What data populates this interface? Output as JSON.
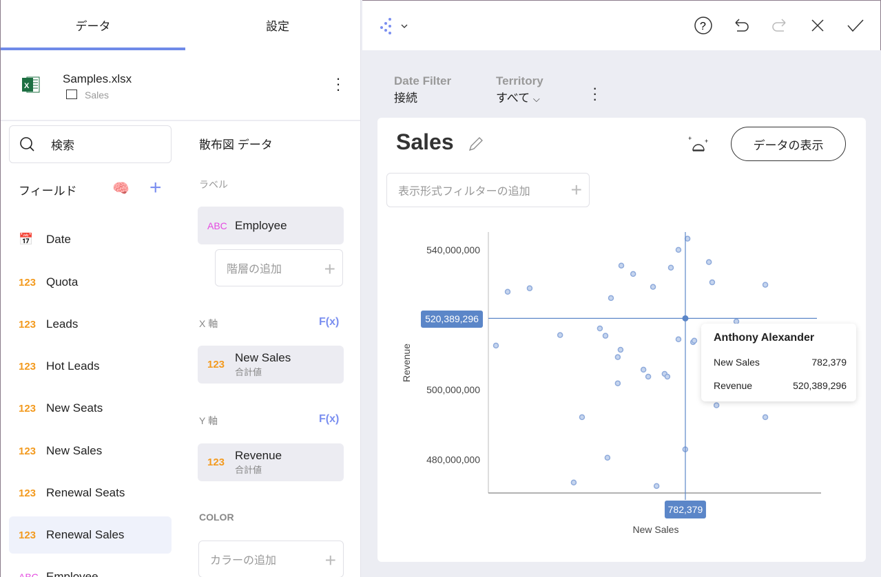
{
  "tabs": [
    {
      "label": "データ",
      "active": true
    },
    {
      "label": "設定",
      "active": false
    }
  ],
  "source": {
    "file": "Samples.xlsx",
    "sheet": "Sales",
    "icon": "excel-icon"
  },
  "search": {
    "placeholder": "検索"
  },
  "fields_header": "フィールド",
  "fields": [
    {
      "type": "date",
      "label": "Date"
    },
    {
      "type": "123",
      "label": "Quota"
    },
    {
      "type": "123",
      "label": "Leads"
    },
    {
      "type": "123",
      "label": "Hot Leads"
    },
    {
      "type": "123",
      "label": "New Seats"
    },
    {
      "type": "123",
      "label": "New Sales"
    },
    {
      "type": "123",
      "label": "Renewal Seats"
    },
    {
      "type": "123",
      "label": "Renewal Sales",
      "selected": true
    },
    {
      "type": "ABC",
      "label": "Employee"
    }
  ],
  "config": {
    "title": "散布図 データ",
    "label_section": "ラベル",
    "label_field": {
      "type": "ABC",
      "name": "Employee"
    },
    "add_hierarchy": "階層の追加",
    "x_section": "X 軸",
    "fx": "F(x)",
    "x_field": {
      "type": "123",
      "name": "New Sales",
      "agg": "合計値"
    },
    "y_section": "Y 軸",
    "y_field": {
      "type": "123",
      "name": "Revenue",
      "agg": "合計値"
    },
    "color_section": "COLOR",
    "add_color": "カラーの追加"
  },
  "filters": [
    {
      "label": "Date Filter",
      "value": "接続"
    },
    {
      "label": "Territory",
      "value": "すべて"
    }
  ],
  "card": {
    "title": "Sales",
    "show_data": "データの表示",
    "add_filter": "表示形式フィルターの追加"
  },
  "accent": "#5b86c8",
  "chart_data": {
    "type": "scatter",
    "xlabel": "New Sales",
    "ylabel": "Revenue",
    "yticks": [
      "540,000,000",
      "500,000,000",
      "480,000,000"
    ],
    "ytick_values": [
      540000000,
      500000000,
      480000000
    ],
    "xlim": [
      0,
      1316000
    ],
    "ylim": [
      470400000,
      545100000
    ],
    "points": [
      [
        30100,
        512600000
      ],
      [
        76600,
        528000000
      ],
      [
        164000,
        529000000
      ],
      [
        285000,
        515600000
      ],
      [
        372000,
        492100000
      ],
      [
        339000,
        473400000
      ],
      [
        443000,
        517500000
      ],
      [
        465000,
        515400000
      ],
      [
        487000,
        526200000
      ],
      [
        528000,
        535500000
      ],
      [
        525000,
        511400000
      ],
      [
        514000,
        509300000
      ],
      [
        514000,
        501800000
      ],
      [
        575000,
        533100000
      ],
      [
        473000,
        480500000
      ],
      [
        616000,
        505700000
      ],
      [
        635000,
        503700000
      ],
      [
        654000,
        529400000
      ],
      [
        668000,
        472400000
      ],
      [
        700000,
        504500000
      ],
      [
        711000,
        503700000
      ],
      [
        725000,
        534900000
      ],
      [
        755000,
        540000000
      ],
      [
        791000,
        543200000
      ],
      [
        755000,
        514400000
      ],
      [
        782000,
        482900000
      ],
      [
        813000,
        513600000
      ],
      [
        818000,
        514000000
      ],
      [
        876000,
        536500000
      ],
      [
        889000,
        530700000
      ],
      [
        985000,
        519500000
      ],
      [
        906000,
        495500000
      ],
      [
        1100000,
        530000000
      ],
      [
        1100000,
        492100000
      ]
    ],
    "selected": {
      "name": "Anthony Alexander",
      "x": 782379,
      "y": 520389296,
      "x_label": "782,379",
      "y_label": "520,389,296"
    },
    "tooltip": {
      "title": "Anthony Alexander",
      "rows": [
        {
          "k": "New Sales",
          "v": "782,379"
        },
        {
          "k": "Revenue",
          "v": "520,389,296"
        }
      ]
    }
  }
}
